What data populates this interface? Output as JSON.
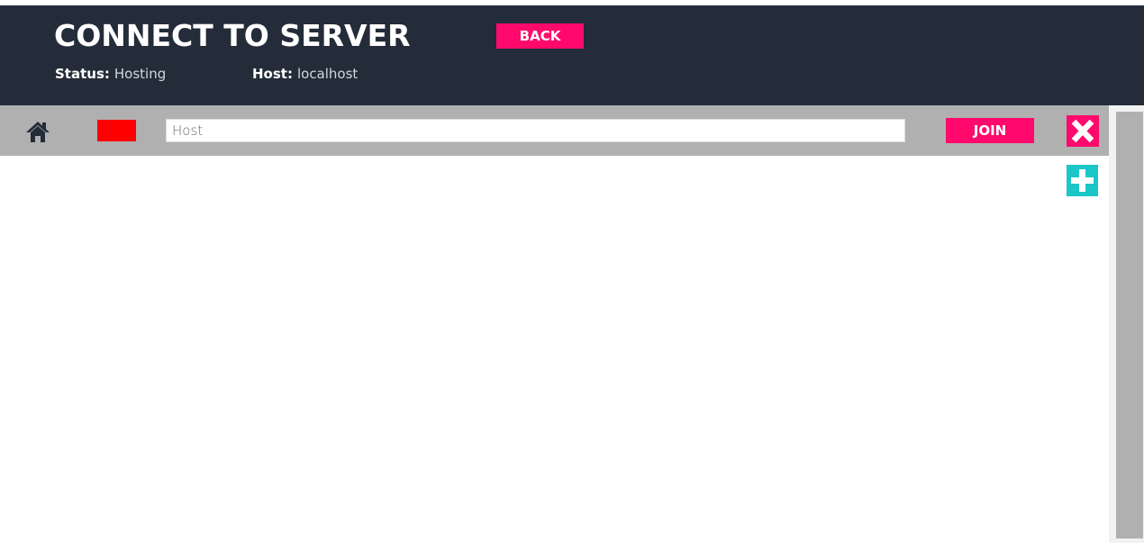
{
  "header": {
    "title": "CONNECT TO SERVER",
    "back_label": "BACK",
    "status_label": "Status:",
    "status_value": "Hosting",
    "host_label": "Host:",
    "host_value": "localhost"
  },
  "toolbar": {
    "home_icon": "home-icon",
    "swatch_color": "#ff0000",
    "host_placeholder": "Host",
    "host_value": "",
    "join_label": "JOIN",
    "close_icon": "close-icon",
    "add_icon": "plus-icon"
  },
  "colors": {
    "header_bg": "#232c38",
    "accent": "#ff0a6c",
    "add_accent": "#1bc6c6",
    "toolbar_bg": "#b0b0b0"
  }
}
